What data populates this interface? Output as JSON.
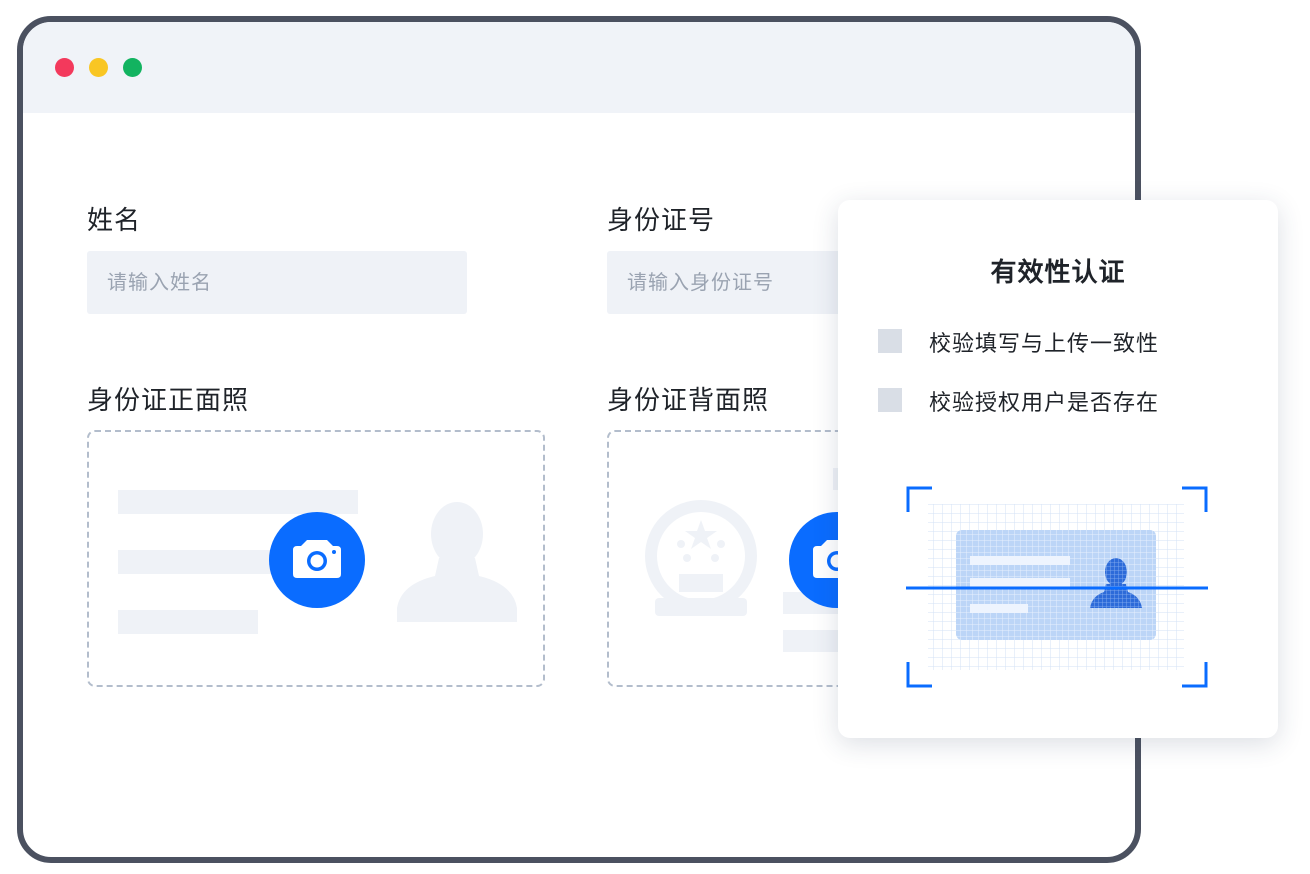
{
  "window": {
    "controls": [
      "close",
      "minimize",
      "maximize"
    ],
    "colors": {
      "close": "#f3395c",
      "minimize": "#f9c623",
      "maximize": "#12b360"
    }
  },
  "form": {
    "name": {
      "label": "姓名",
      "placeholder": "请输入姓名"
    },
    "id_number": {
      "label": "身份证号",
      "placeholder": "请输入身份证号"
    },
    "id_front": {
      "label": "身份证正面照",
      "icon": "camera-icon"
    },
    "id_back": {
      "label": "身份证背面照",
      "icon": "camera-icon"
    }
  },
  "verification": {
    "title": "有效性认证",
    "options": [
      {
        "label": "校验填写与上传一致性",
        "checked": false
      },
      {
        "label": "校验授权用户是否存在",
        "checked": false
      }
    ],
    "illustration": "id-card-scan-icon"
  },
  "colors": {
    "accent": "#0a6cff",
    "frame": "#4b5160",
    "field_bg": "#eff2f7"
  }
}
